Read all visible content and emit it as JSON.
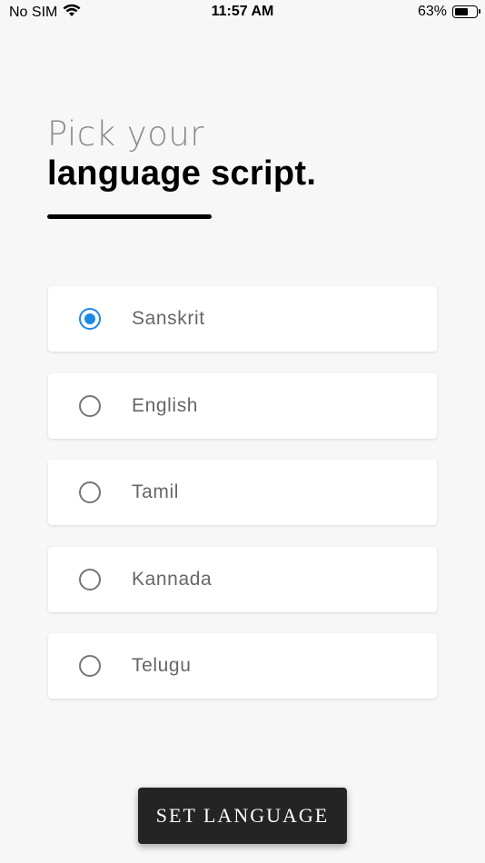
{
  "status_bar": {
    "carrier": "No SIM",
    "time": "11:57 AM",
    "battery": "63%",
    "battery_level": 0.63
  },
  "heading": {
    "line1": "Pick your",
    "line2": "language script."
  },
  "options": [
    {
      "label": "Sanskrit",
      "selected": true
    },
    {
      "label": "English",
      "selected": false
    },
    {
      "label": "Tamil",
      "selected": false
    },
    {
      "label": "Kannada",
      "selected": false
    },
    {
      "label": "Telugu",
      "selected": false
    }
  ],
  "button": {
    "label": "SET LANGUAGE"
  },
  "colors": {
    "accent": "#1e88e5",
    "button_bg": "#242424",
    "background": "#f7f7f7"
  }
}
